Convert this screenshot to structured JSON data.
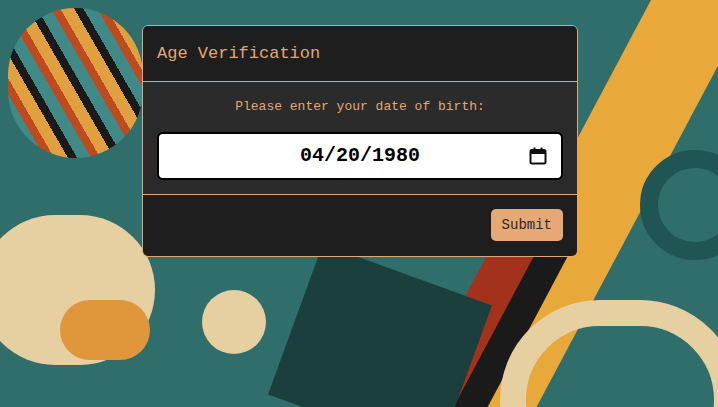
{
  "dialog": {
    "title": "Age Verification",
    "prompt": "Please enter your date of birth:",
    "date_field": {
      "value": "04/20/1980"
    },
    "buttons": [
      "Submit"
    ]
  }
}
